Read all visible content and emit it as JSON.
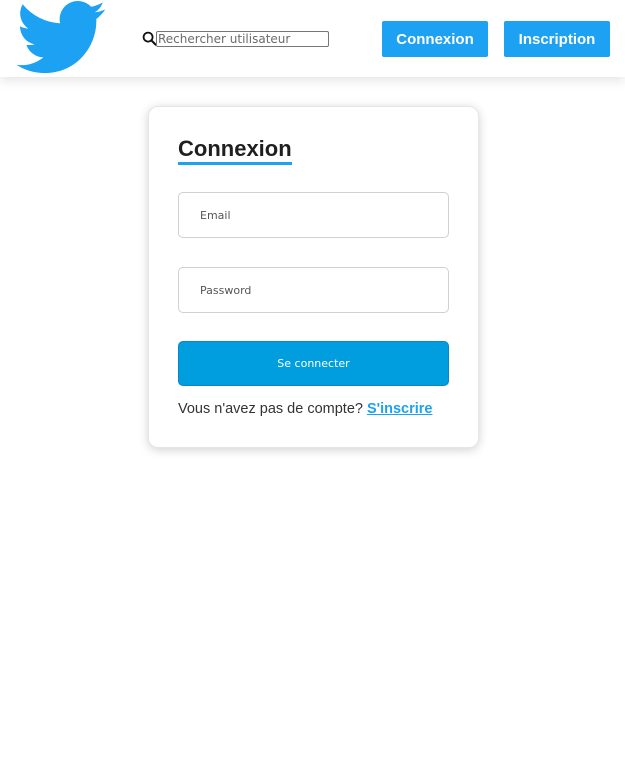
{
  "header": {
    "logo_icon": "twitter-bird-icon",
    "search": {
      "icon": "search-icon",
      "placeholder": "Rechercher utilisateur",
      "value": ""
    },
    "login_label": "Connexion",
    "signup_label": "Inscription"
  },
  "login_card": {
    "title": "Connexion",
    "email": {
      "placeholder": "Email",
      "value": ""
    },
    "password": {
      "placeholder": "Password",
      "value": ""
    },
    "submit_label": "Se connecter",
    "no_account_text": "Vous n'avez pas de compte?",
    "signup_link": "S'inscrire"
  },
  "colors": {
    "brand": "#1da1f2",
    "submit": "#009ddf",
    "text": "#1f1f1f"
  }
}
